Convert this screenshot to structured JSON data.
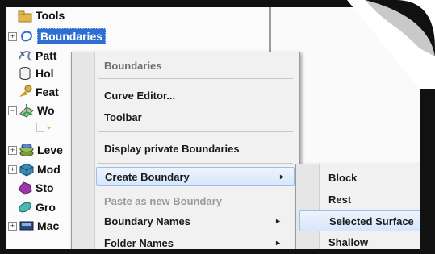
{
  "tree": {
    "items": [
      {
        "label": "Tools",
        "icon": "tools-folder-icon",
        "expander": ""
      },
      {
        "label": "Boundaries",
        "icon": "boundaries-icon",
        "expander": "+",
        "selected": true
      },
      {
        "label": "Patt",
        "icon": "patterns-icon",
        "expander": ""
      },
      {
        "label": "Hol",
        "icon": "holes-icon",
        "expander": ""
      },
      {
        "label": "Feat",
        "icon": "features-icon",
        "expander": ""
      },
      {
        "label": "Wo",
        "icon": "workplanes-icon",
        "expander": "−"
      },
      {
        "label": "",
        "icon": "workplane-child-icon",
        "expander": ""
      },
      {
        "label": "Leve",
        "icon": "levels-icon",
        "expander": "+"
      },
      {
        "label": "Mod",
        "icon": "models-icon",
        "expander": "+"
      },
      {
        "label": "Sto",
        "icon": "stock-icon",
        "expander": ""
      },
      {
        "label": "Gro",
        "icon": "groups-icon",
        "expander": ""
      },
      {
        "label": "Mac",
        "icon": "machine-icon",
        "expander": "+"
      }
    ]
  },
  "context_menu": {
    "header": "Boundaries",
    "curve_editor": "Curve Editor...",
    "toolbar": "Toolbar",
    "display_private": "Display private Boundaries",
    "create_boundary": "Create Boundary",
    "paste_new": "Paste as new Boundary",
    "boundary_names": "Boundary Names",
    "folder_names": "Folder Names",
    "submenu_arrow": "►"
  },
  "submenu": {
    "block": "Block",
    "rest": "Rest",
    "selected_surface": "Selected Surface",
    "shallow": "Shallow"
  },
  "colors": {
    "selection": "#2f6fd1",
    "highlight": "#d6e6fb",
    "frame": "#111111"
  }
}
